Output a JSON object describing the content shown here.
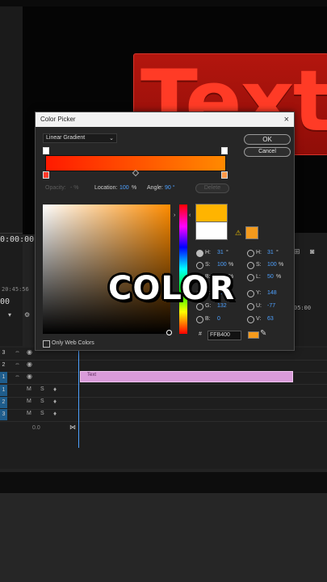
{
  "monitor": {
    "graphic_text": "Text",
    "timecode": "0:00:00"
  },
  "left_panel": {
    "timecode": "20:45:56",
    "marker": "00"
  },
  "right_panel": {
    "timecode": "05:00"
  },
  "dialog": {
    "title": "Color Picker",
    "close": "×",
    "gradient_type": "Linear Gradient",
    "ok": "OK",
    "cancel": "Cancel",
    "opacity_label": "Opacity:",
    "opacity_value": "- %",
    "location_label": "Location:",
    "location_value": "100",
    "location_unit": "%",
    "angle_label": "Angle:",
    "angle_value": "90 °",
    "delete": "Delete",
    "only_web_colors": "Only Web Colors",
    "hex": "FFB400",
    "hsb": [
      {
        "label": "H:",
        "value": "31",
        "unit": "°"
      },
      {
        "label": "S:",
        "value": "100",
        "unit": "%"
      },
      {
        "label": "B:",
        "value": "100",
        "unit": "%"
      }
    ],
    "rgb": [
      {
        "label": "R:",
        "value": "255"
      },
      {
        "label": "G:",
        "value": "132"
      },
      {
        "label": "B:",
        "value": "0"
      }
    ],
    "hsl": [
      {
        "label": "H:",
        "value": "31",
        "unit": "°"
      },
      {
        "label": "S:",
        "value": "100",
        "unit": "%"
      },
      {
        "label": "L:",
        "value": "50",
        "unit": "%"
      }
    ],
    "yuv": [
      {
        "label": "Y:",
        "value": "148"
      },
      {
        "label": "U:",
        "value": "-77"
      },
      {
        "label": "V:",
        "value": "63"
      }
    ],
    "colors": {
      "new": "#ffb400",
      "old": "#ffffff",
      "gradient_start": "#ff1a00",
      "gradient_end": "#ff8a00"
    }
  },
  "timeline": {
    "video_tracks": [
      "3",
      "2",
      "1"
    ],
    "audio_tracks": [
      "1",
      "2",
      "3"
    ],
    "clip_label": "Text",
    "footer_value": "0.0"
  },
  "caption": "COLOR"
}
